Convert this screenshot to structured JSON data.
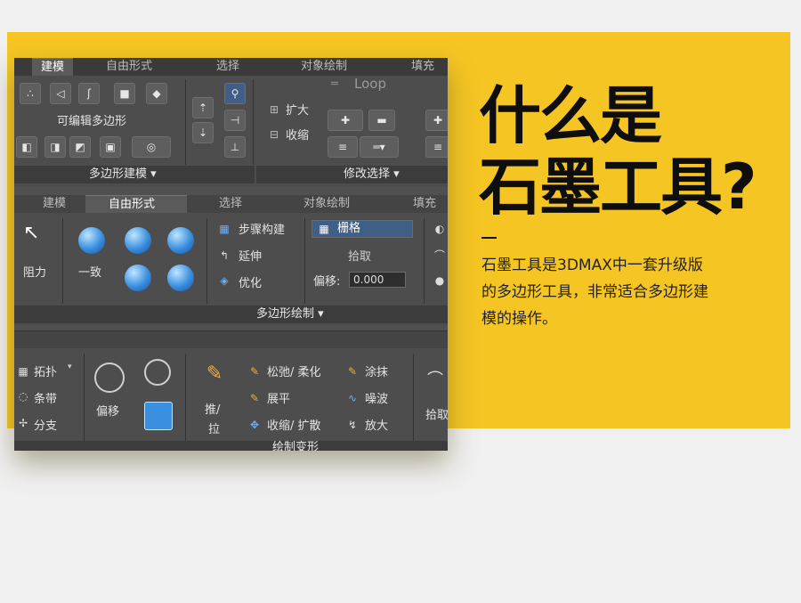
{
  "headline": {
    "line1": "什么是",
    "line2": "石墨工具?"
  },
  "description": {
    "line1": "石墨工具是3DMAX中一套升级版",
    "line2": "的多边形工具，非常适合多边形建",
    "line3": "模的操作。"
  },
  "ribbon1": {
    "tabs": [
      "建模",
      "自由形式",
      "选择",
      "对象绘制",
      "填充"
    ],
    "editable_poly": "可编辑多边形",
    "grow": "扩大",
    "shrink": "收缩",
    "loop": "Loop",
    "group_poly_modeling": "多边形建模 ▾",
    "group_modify_selection": "修改选择 ▾"
  },
  "ribbon2": {
    "tabs": [
      "建模",
      "自由形式",
      "选择",
      "对象绘制",
      "填充"
    ],
    "drag": "阻力",
    "conform": "一致",
    "step_build": "步骤构建",
    "extend": "延伸",
    "optimize": "优化",
    "grid_dropdown": "栅格",
    "pick": "拾取",
    "offset_label": "偏移:",
    "offset_value": "0.000",
    "group_poly_draw": "多边形绘制 ▾"
  },
  "ribbon3": {
    "topology": "拓扑",
    "strips": "条带",
    "branches": "分支",
    "shift": "偏移",
    "push_pull": "推/",
    "push_pull2": "拉",
    "relax_soften": "松弛/ 柔化",
    "flatten": "展平",
    "contract_expand": "收缩/ 扩散",
    "smudge": "涂抹",
    "noise": "噪波",
    "enlarge": "放大",
    "pick": "拾取",
    "group_paint_deform": "绘制变形"
  }
}
